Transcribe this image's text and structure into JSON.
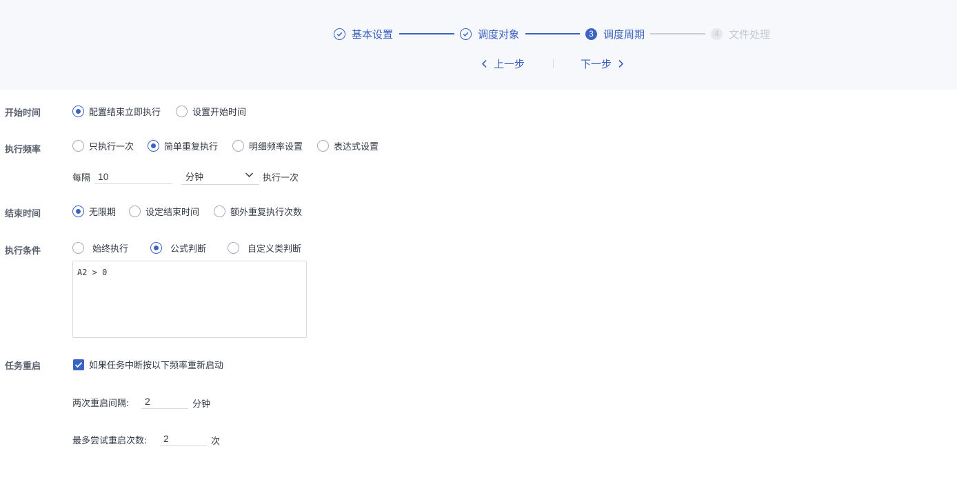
{
  "steps": [
    {
      "num": "",
      "label": "基本设置",
      "state": "done"
    },
    {
      "num": "",
      "label": "调度对象",
      "state": "done"
    },
    {
      "num": "3",
      "label": "调度周期",
      "state": "current"
    },
    {
      "num": "4",
      "label": "文件处理",
      "state": "todo"
    }
  ],
  "nav": {
    "prev": "上一步",
    "next": "下一步"
  },
  "start_time": {
    "label": "开始时间",
    "options": [
      "配置结束立即执行",
      "设置开始时间"
    ],
    "selected": "配置结束立即执行"
  },
  "frequency": {
    "label": "执行频率",
    "options": [
      "只执行一次",
      "简单重复执行",
      "明细频率设置",
      "表达式设置"
    ],
    "selected": "简单重复执行",
    "every_prefix": "每隔",
    "interval_value": "10",
    "unit": "分钟",
    "every_suffix": "执行一次"
  },
  "end_time": {
    "label": "结束时间",
    "options": [
      "无限期",
      "设定结束时间",
      "额外重复执行次数"
    ],
    "selected": "无限期"
  },
  "condition": {
    "label": "执行条件",
    "options": [
      "始终执行",
      "公式判断",
      "自定义类判断"
    ],
    "selected": "公式判断",
    "formula": "A2 > 0"
  },
  "restart": {
    "label": "任务重启",
    "checkbox_label": "如果任务中断按以下频率重新启动",
    "checked": true,
    "interval_label": "两次重启间隔:",
    "interval_value": "2",
    "interval_unit": "分钟",
    "max_label": "最多尝试重启次数:",
    "max_value": "2",
    "max_unit": "次"
  },
  "colors": {
    "accent": "#3a64c4",
    "header_bg": "#f6f8fb",
    "inactive": "#c9ccd4"
  }
}
